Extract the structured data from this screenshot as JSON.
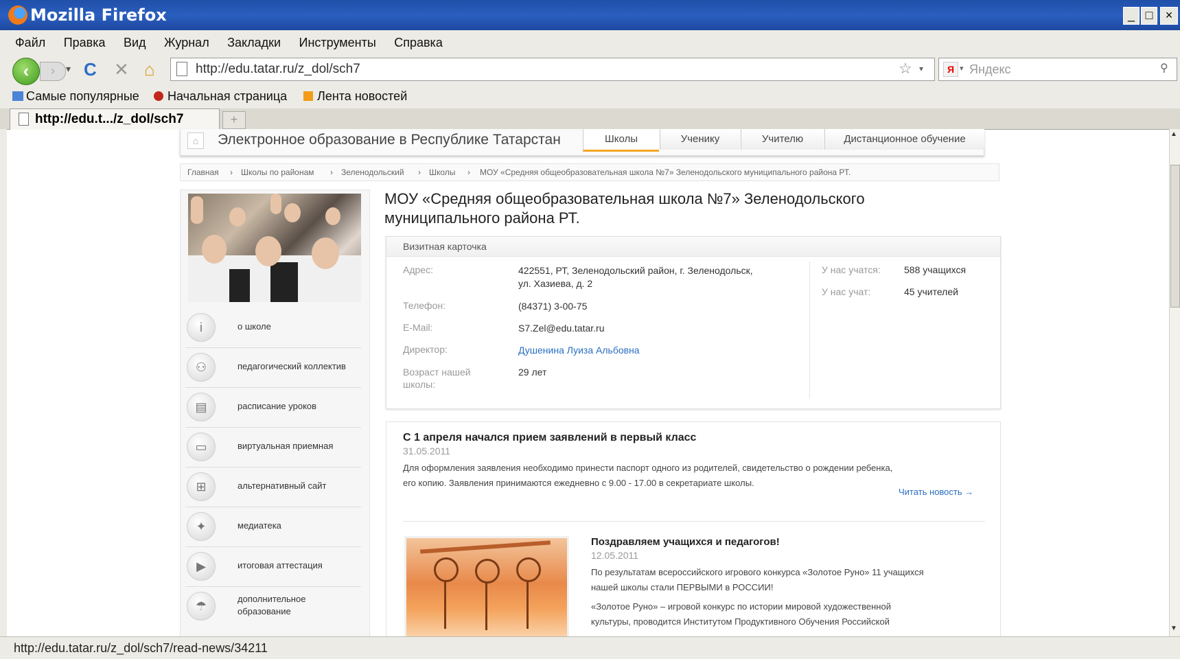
{
  "window": {
    "title": "Mozilla Firefox",
    "controls": [
      "_",
      "□",
      "×"
    ]
  },
  "menu": [
    "Файл",
    "Правка",
    "Вид",
    "Журнал",
    "Закладки",
    "Инструменты",
    "Справка"
  ],
  "nav": {
    "back": "‹",
    "forward": "›",
    "reload": "C",
    "stop": "✕",
    "home": "⌂",
    "url": "http://edu.tatar.ru/z_dol/sch7",
    "star": "☆",
    "search_engine": "Я",
    "search_placeholder": "Яндекс",
    "search_go": "🔍"
  },
  "bookmarks": [
    "Самые популярные",
    "Начальная страница",
    "Лента новостей"
  ],
  "tab": {
    "label": "http://edu.t.../z_dol/sch7",
    "new_tab": "+"
  },
  "status_text": "http://edu.tatar.ru/z_dol/sch7/read-news/34211",
  "site": {
    "brand": "Электронное образование в Республике Татарстан",
    "home_icon": "⌂",
    "tabs": [
      "Школы",
      "Ученику",
      "Учителю",
      "Дистанционное обучение"
    ],
    "active_tab": "Школы",
    "breadcrumb": [
      "Главная",
      "Школы по районам",
      "Зеленодольский",
      "Школы",
      "МОУ «Средняя общеобразовательная школа №7» Зеленодольского муниципального района РТ."
    ],
    "breadcrumb_sep": "›",
    "school_name_line1": "МОУ «Средняя общеобразовательная школа №7» Зеленодольского",
    "school_name_line2": "муниципального района РТ."
  },
  "sidebar": [
    {
      "label": "о школе",
      "icon": "info-icon",
      "glyph": "i"
    },
    {
      "label": "педагогический коллектив",
      "icon": "staff-icon",
      "glyph": "⚇"
    },
    {
      "label": "расписание уроков",
      "icon": "schedule-icon",
      "glyph": "▤"
    },
    {
      "label": "виртуальная приемная",
      "icon": "reception-icon",
      "glyph": "▭"
    },
    {
      "label": "альтернативный сайт",
      "icon": "site-icon",
      "glyph": "⊞"
    },
    {
      "label": "медиатека",
      "icon": "media-icon",
      "glyph": "✦"
    },
    {
      "label": "итоговая аттестация",
      "icon": "play-icon",
      "glyph": "▶"
    },
    {
      "label_line1": "дополнительное",
      "label_line2": "образование",
      "icon": "extra-icon",
      "glyph": "☂"
    }
  ],
  "card": {
    "title": "Визитная карточка",
    "address_key": "Адрес:",
    "address_line1": "422551, РТ, Зеленодольский район, г. Зеленодольск,",
    "address_line2": "ул. Хазиева, д. 2",
    "phone_key": "Телефон:",
    "phone": "(84371) 3-00-75",
    "email_key": "E-Mail:",
    "email": "S7.Zel@edu.tatar.ru",
    "director_key": "Директор:",
    "director": "Душенина Луиза Альбовна",
    "age_key_line1": "Возраст нашей",
    "age_key_line2": "школы:",
    "age": "29 лет",
    "students_key": "У нас учатся:",
    "students": "588 учащихся",
    "teachers_key": "У нас учат:",
    "teachers": "45 учителей"
  },
  "news": [
    {
      "title": "С 1 апреля начался прием заявлений в первый класс",
      "date": "31.05.2011",
      "text_line1": "Для оформления заявления необходимо принести паспорт одного из родителей, свидетельство о рождении ребенка,",
      "text_line2": "его копию. Заявления принимаются ежедневно с 9.00 - 17.00 в секретариате школы.",
      "more": "Читать новость →"
    },
    {
      "title": "Поздравляем учащихся и педагогов!",
      "date": "12.05.2011",
      "text_line1": "По результатам всероссийского игрового конкурса «Золотое Руно» 11 учащихся",
      "text_line2": "нашей школы стали ПЕРВЫМИ в РОССИИ!",
      "text_line3": "«Золотое Руно» – игровой конкурс по истории мировой художественной",
      "text_line4": "культуры, проводится Институтом Продуктивного Обучения Российской"
    }
  ]
}
